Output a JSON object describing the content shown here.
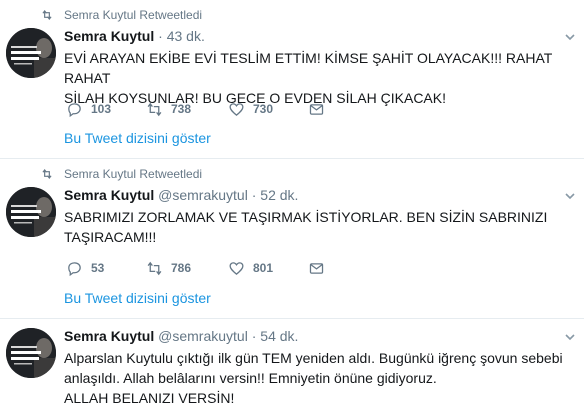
{
  "tweets": [
    {
      "retweet_text": "Semra Kuytul Retweetledi",
      "name": "Semra Kuytul",
      "handle": "",
      "separator": "·",
      "time": "43 dk.",
      "text_line1": "EVİ ARAYAN EKİBE EVİ TESLİM ETTİM! KİMSE ŞAHİT OLAYACAK!!! RAHAT RAHAT",
      "text_line2": "SİLAH KOYSUNLAR! BU GECE O EVDEN SİLAH ÇIKACAK!",
      "text_line3": "",
      "replies": "103",
      "retweets": "738",
      "likes": "730",
      "thread_link": "Bu Tweet dizisini göster"
    },
    {
      "retweet_text": "Semra Kuytul Retweetledi",
      "name": "Semra Kuytul",
      "handle": "@semrakuytul",
      "separator": "·",
      "time": "52 dk.",
      "text_line1": "SABRIMIZI ZORLAMAK VE TAŞIRMAK İSTİYORLAR. BEN SİZİN SABRINIZI",
      "text_line2": "TAŞIRACAM!!!",
      "text_line3": "",
      "replies": "53",
      "retweets": "786",
      "likes": "801",
      "thread_link": "Bu Tweet dizisini göster"
    },
    {
      "retweet_text": "",
      "name": "Semra Kuytul",
      "handle": "@semrakuytul",
      "separator": "·",
      "time": "54 dk.",
      "text_line1": "Alparslan Kuytulu çıktığı ilk gün TEM yeniden aldı. Bugünkü iğrenç şovun sebebi",
      "text_line2": "anlaşıldı. Allah belâlarını versin!! Emniyetin önüne gidiyoruz.",
      "text_line3": "ALLAH BELANIZI VERSİN!",
      "replies": "",
      "retweets": "",
      "likes": "",
      "thread_link": ""
    }
  ],
  "colors": {
    "text": "#14171a",
    "secondary": "#657786",
    "link": "#1b95e0",
    "divider": "#e6ecf0"
  },
  "icons": [
    "retweet-icon",
    "reply-icon",
    "like-icon",
    "message-icon",
    "chevron-down-icon"
  ]
}
